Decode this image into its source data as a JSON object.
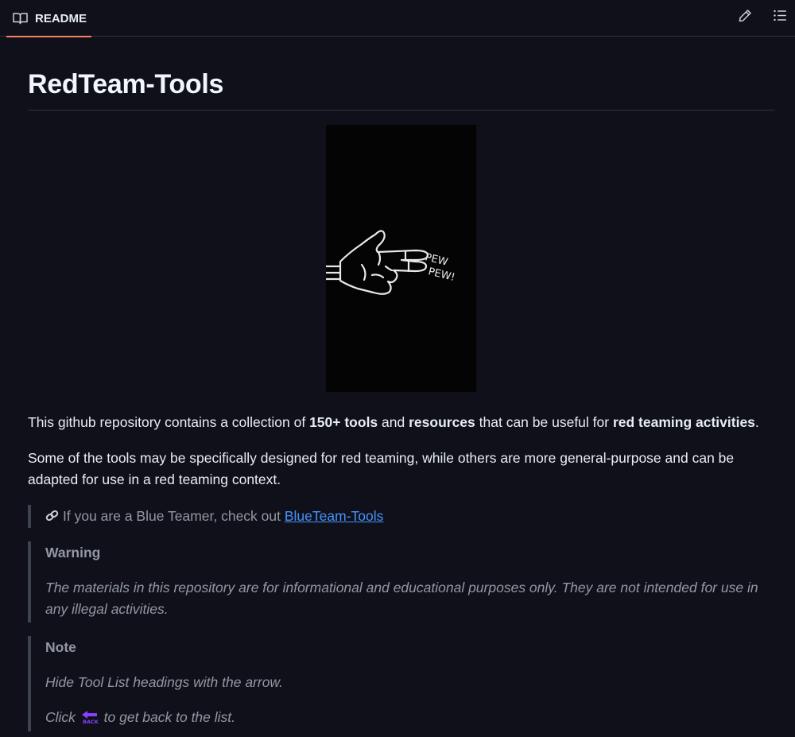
{
  "tab": {
    "label": "README",
    "accent": "#f78166"
  },
  "readme": {
    "title": "RedTeam-Tools",
    "intro": {
      "p1": "This github repository contains a collection of ",
      "b1": "150+ tools",
      "p2": " and ",
      "b2": "resources",
      "p3": " that can be useful for ",
      "b3": "red teaming activities",
      "p4": "."
    },
    "paragraph2": "Some of the tools may be specifically designed for red teaming, while others are more general-purpose and can be adapted for use in a red teaming context.",
    "blue_note": {
      "prefix": "If you are a Blue Teamer, check out ",
      "link": "BlueTeam-Tools"
    },
    "warning": {
      "title": "Warning",
      "body": "The materials in this repository are for informational and educational purposes only. They are not intended for use in any illegal activities."
    },
    "note": {
      "title": "Note",
      "line1": "Hide Tool List headings with the arrow.",
      "line2_prefix": "Click ",
      "line2_suffix": " to get back to the list."
    },
    "hero_text": "PEW PEW!"
  },
  "icons": {
    "tab": "book-icon",
    "edit": "pencil-icon",
    "toc": "list-icon",
    "link": "link-icon",
    "back": "back-arrow-icon"
  },
  "colors": {
    "background": "#10101a",
    "link": "#4493f8",
    "muted": "#9198a1",
    "back_icon": "#8a3ffc"
  }
}
